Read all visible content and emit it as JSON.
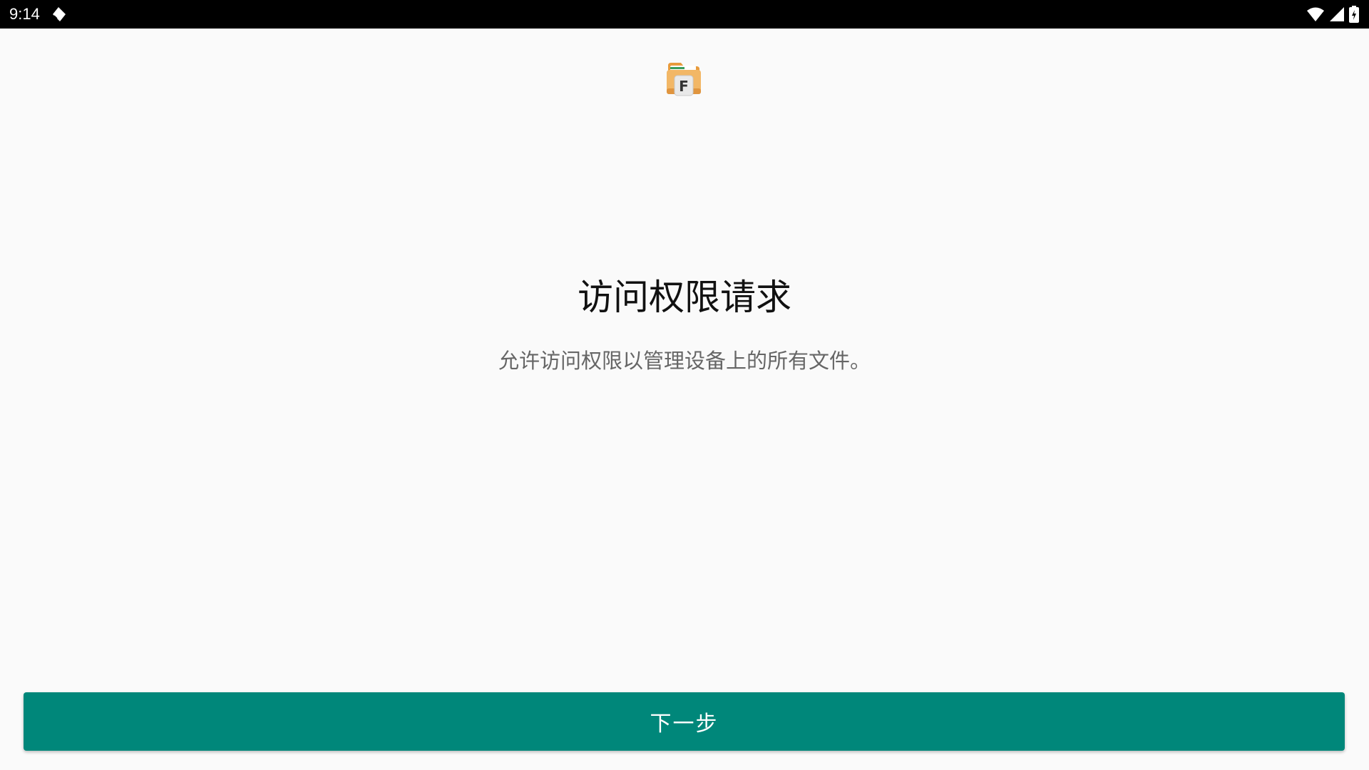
{
  "status_bar": {
    "time": "9:14",
    "left_icon": "notification-shape-icon",
    "right_icons": [
      "wifi-icon",
      "cellular-signal-icon",
      "battery-charging-icon"
    ]
  },
  "app": {
    "icon": "file-manager-app-icon",
    "icon_letter": "F"
  },
  "content": {
    "title": "访问权限请求",
    "subtitle": "允许访问权限以管理设备上的所有文件。"
  },
  "actions": {
    "next_label": "下一步"
  },
  "colors": {
    "background": "#fafafa",
    "status_bar": "#000000",
    "accent": "#00877a",
    "title_text": "#111111",
    "subtitle_text": "#666666"
  }
}
